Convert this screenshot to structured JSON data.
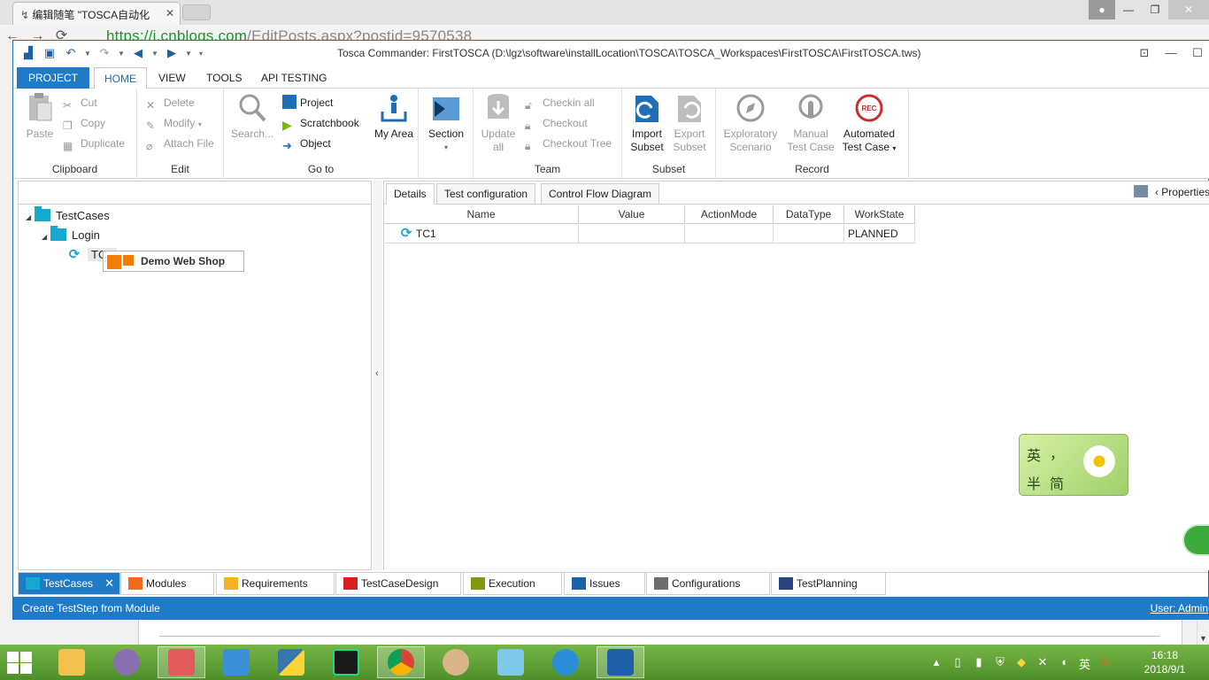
{
  "browser": {
    "tab_title": "编辑随笔 \"TOSCA自动化",
    "url_prefix": "https://i.cnblogs.com",
    "url_rest": "/EditPosts.aspx?postid=9570538"
  },
  "window": {
    "title": "Tosca Commander: FirstTOSCA (D:\\lgz\\software\\installLocation\\TOSCA\\TOSCA_Workspaces\\FirstTOSCA\\FirstTOSCA.tws)"
  },
  "ribbon_tabs": [
    "PROJECT",
    "HOME",
    "VIEW",
    "TOOLS",
    "API TESTING"
  ],
  "ribbon": {
    "clipboard": {
      "label": "Clipboard",
      "paste": "Paste",
      "cut": "Cut",
      "copy": "Copy",
      "duplicate": "Duplicate"
    },
    "edit": {
      "label": "Edit",
      "delete": "Delete",
      "modify": "Modify",
      "attach": "Attach File"
    },
    "goto": {
      "label": "Go to",
      "search": "Search...",
      "project": "Project",
      "scratchbook": "Scratchbook",
      "object": "Object",
      "myarea": "My Area"
    },
    "section": {
      "label": "Section"
    },
    "team": {
      "label": "Team",
      "update_l1": "Update",
      "update_l2": "all",
      "checkin_all": "Checkin all",
      "checkout": "Checkout",
      "checkout_tree": "Checkout Tree"
    },
    "subset": {
      "label": "Subset",
      "import_l1": "Import",
      "import_l2": "Subset",
      "export_l1": "Export",
      "export_l2": "Subset"
    },
    "record": {
      "label": "Record",
      "exploratory_l1": "Exploratory",
      "exploratory_l2": "Scenario",
      "manual_l1": "Manual",
      "manual_l2": "Test Case",
      "automated_l1": "Automated",
      "automated_l2": "Test Case",
      "rec_badge": "REC"
    }
  },
  "tree": {
    "root": "TestCases",
    "folder": "Login",
    "testcase": "TC1",
    "drag_label": "Demo Web Shop"
  },
  "details": {
    "tabs": [
      "Details",
      "Test configuration",
      "Control Flow Diagram"
    ],
    "properties": "Properties",
    "columns": [
      "Name",
      "Value",
      "ActionMode",
      "DataType",
      "WorkState"
    ],
    "rows": [
      {
        "name": "TC1",
        "value": "",
        "actionmode": "",
        "datatype": "",
        "workstate": "PLANNED"
      }
    ]
  },
  "bottom_tabs": [
    "TestCases",
    "Modules",
    "Requirements",
    "TestCaseDesign",
    "Execution",
    "Issues",
    "Configurations",
    "TestPlanning"
  ],
  "status": {
    "left": "Create TestStep from Module",
    "right": "User: Admin"
  },
  "ime": {
    "c1": "英",
    "c2": "，",
    "c3": "半",
    "c4": "简"
  },
  "taskbar": {
    "time": "16:18",
    "date": "2018/9/1",
    "lang": "英"
  },
  "colors": {
    "accent": "#1f7ac7",
    "folder": "#16a9d0",
    "record_red": "#c9302c"
  }
}
